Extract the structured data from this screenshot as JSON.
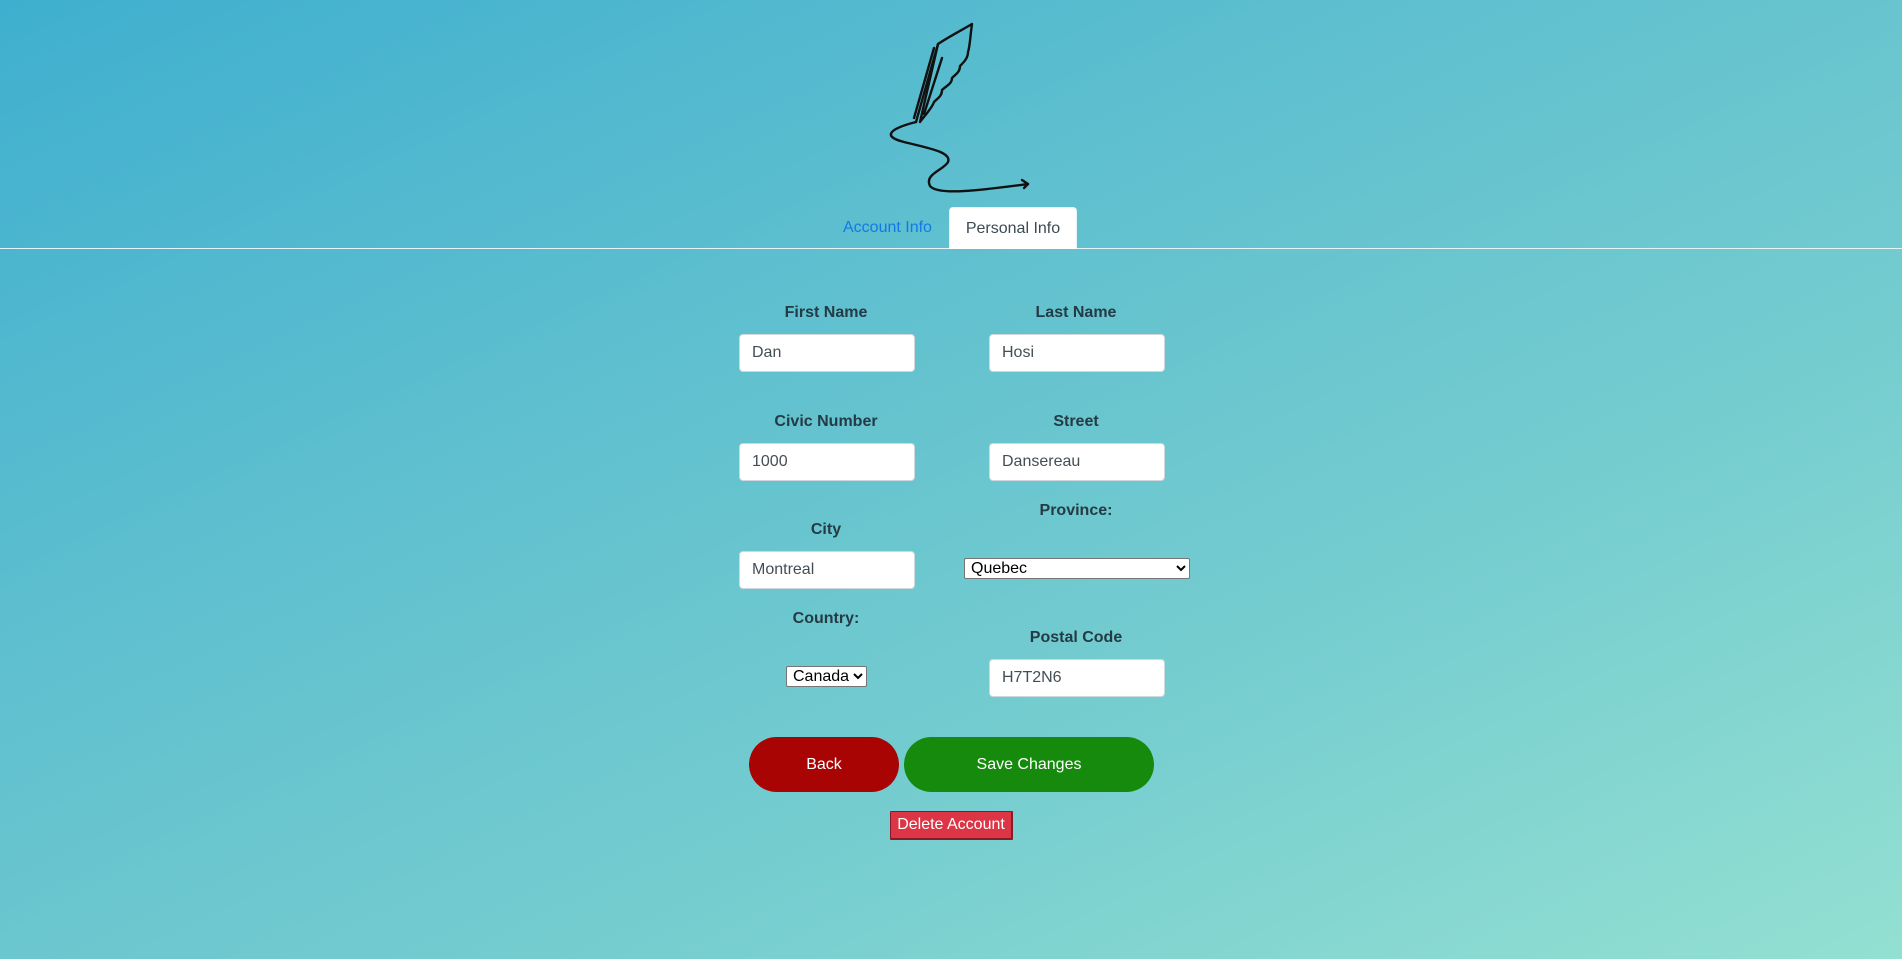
{
  "tabs": {
    "account_label": "Account Info",
    "personal_label": "Personal Info"
  },
  "form": {
    "first_name": {
      "label": "First Name",
      "value": "Dan"
    },
    "last_name": {
      "label": "Last Name",
      "value": "Hosi"
    },
    "civic_number": {
      "label": "Civic Number",
      "value": "1000"
    },
    "street": {
      "label": "Street",
      "value": "Dansereau"
    },
    "city": {
      "label": "City",
      "value": "Montreal"
    },
    "province": {
      "label": "Province:",
      "selected": "Quebec"
    },
    "country": {
      "label": "Country:",
      "selected": "Canada"
    },
    "postal_code": {
      "label": "Postal Code",
      "value": "H7T2N6"
    }
  },
  "actions": {
    "back_label": "Back",
    "save_label": "Save Changes",
    "delete_label": "Delete Account"
  },
  "icons": {
    "logo": "quill-pen-icon"
  },
  "colors": {
    "tab_link": "#1479e8",
    "back_button": "#a80404",
    "save_button": "#168a0d",
    "delete_button": "#dc3545"
  }
}
